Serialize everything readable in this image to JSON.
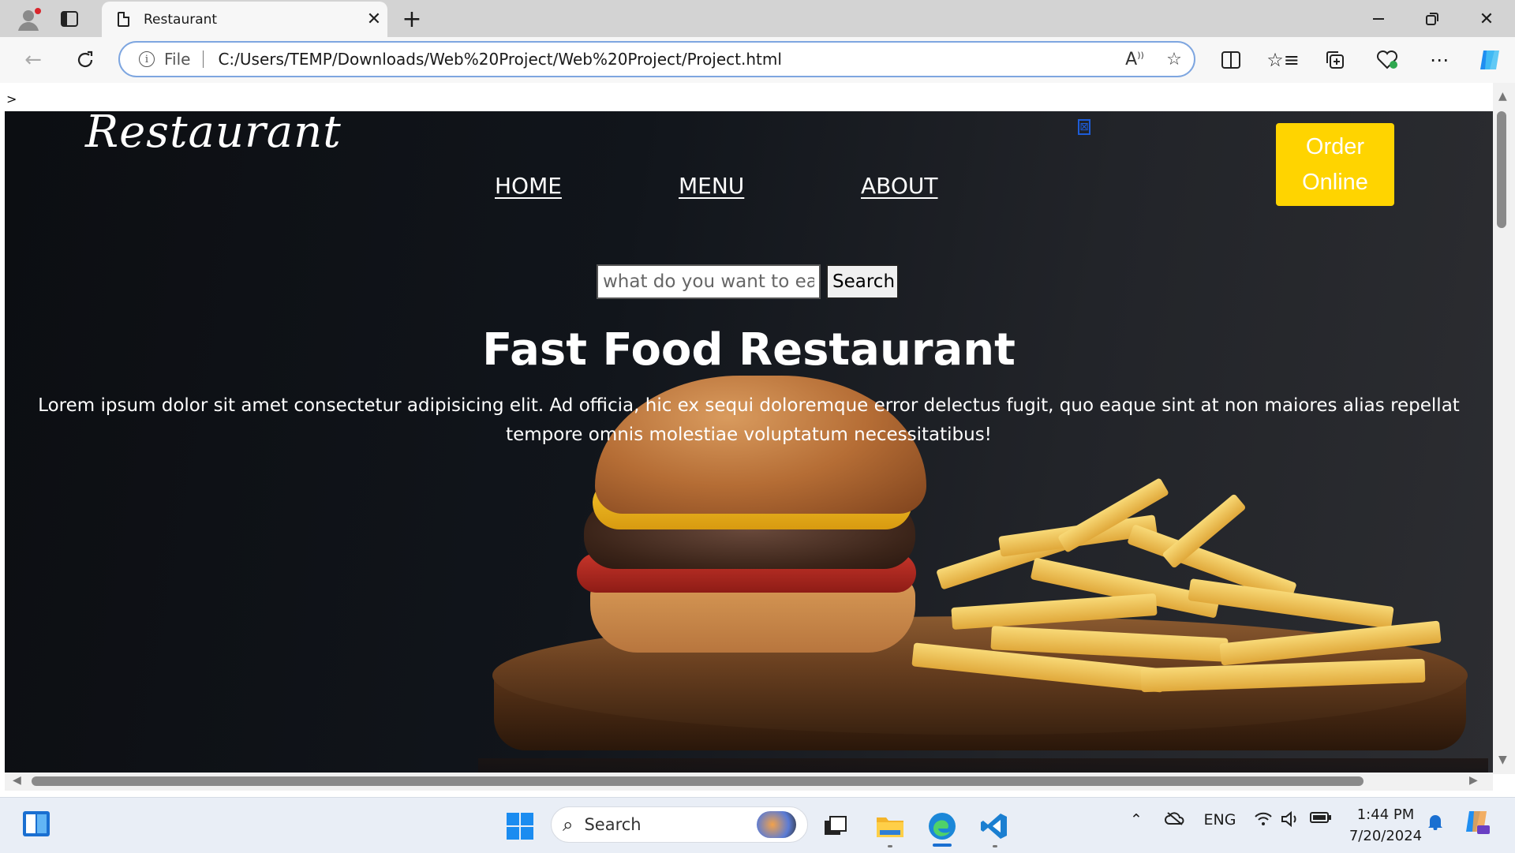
{
  "browser": {
    "tab_title": "Restaurant",
    "address": {
      "scheme_label": "File",
      "url": "C:/Users/TEMP/Downloads/Web%20Project/Web%20Project/Project.html"
    }
  },
  "page": {
    "stray_text": ">",
    "logo": "Restaurant",
    "nav": [
      {
        "label": "HOME"
      },
      {
        "label": "MENU"
      },
      {
        "label": "ABOUT"
      }
    ],
    "broken_image_glyph": "⊠",
    "order_button": {
      "line1": "Order",
      "line2": "Online"
    },
    "search": {
      "placeholder": "what do you want to eat?",
      "button": "Search"
    },
    "hero_title": "Fast Food Restaurant",
    "hero_text": "Lorem ipsum dolor sit amet consectetur adipisicing elit. Ad officia, hic ex sequi doloremque error delectus fugit, quo eaque sint at non maiores alias repellat tempore omnis molestiae voluptatum necessitatibus!"
  },
  "colors": {
    "order_button_bg": "#ffd400",
    "hero_bg": "#0c0e12",
    "address_border": "#7ea6e0"
  },
  "taskbar": {
    "search_label": "Search",
    "language": "ENG",
    "time": "1:44 PM",
    "date": "7/20/2024"
  }
}
